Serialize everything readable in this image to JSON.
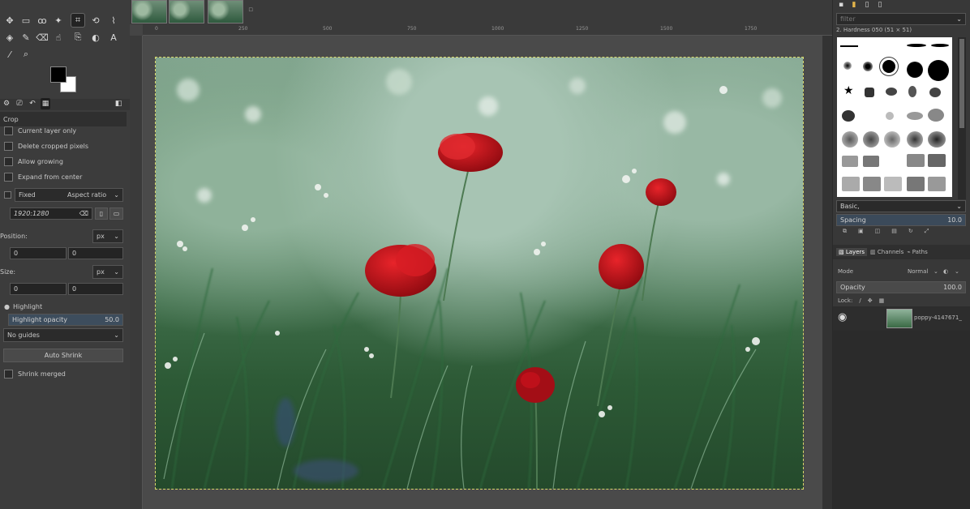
{
  "tool_options": {
    "section_title": "Crop",
    "current_layer_only": "Current layer only",
    "delete_cropped_pixels": "Delete cropped pixels",
    "allow_growing": "Allow growing",
    "expand_from_center": "Expand from center",
    "fixed_label": "Fixed",
    "fixed_value": "Aspect ratio",
    "ratio_value": "1920:1280",
    "position_label": "Position:",
    "position_unit": "px",
    "position_x": "0",
    "position_y": "0",
    "size_label": "Size:",
    "size_unit": "px",
    "size_w": "0",
    "size_h": "0",
    "highlight_label": "Highlight",
    "highlight_opacity_label": "Highlight opacity",
    "highlight_opacity_value": "50.0",
    "guides_value": "No guides",
    "auto_shrink": "Auto Shrink",
    "shrink_merged": "Shrink merged"
  },
  "ruler": {
    "ticks": [
      "0",
      "250",
      "500",
      "750",
      "1000",
      "1250",
      "1500",
      "1750"
    ]
  },
  "brushes": {
    "filter_placeholder": "filter",
    "title": "2. Hardness 050 (51 × 51)",
    "tag_value": "Basic,",
    "spacing_label": "Spacing",
    "spacing_value": "10.0"
  },
  "layers": {
    "tab_layers": "Layers",
    "tab_channels": "Channels",
    "tab_paths": "Paths",
    "mode_label": "Mode",
    "mode_value": "Normal",
    "opacity_label": "Opacity",
    "opacity_value": "100.0",
    "lock_label": "Lock:",
    "layer_name": "poppy-4147671_"
  },
  "colors": {
    "poppy_red": "#c8121a",
    "dock_bg": "#383838",
    "toolbox_bg": "#3c3c3c"
  }
}
